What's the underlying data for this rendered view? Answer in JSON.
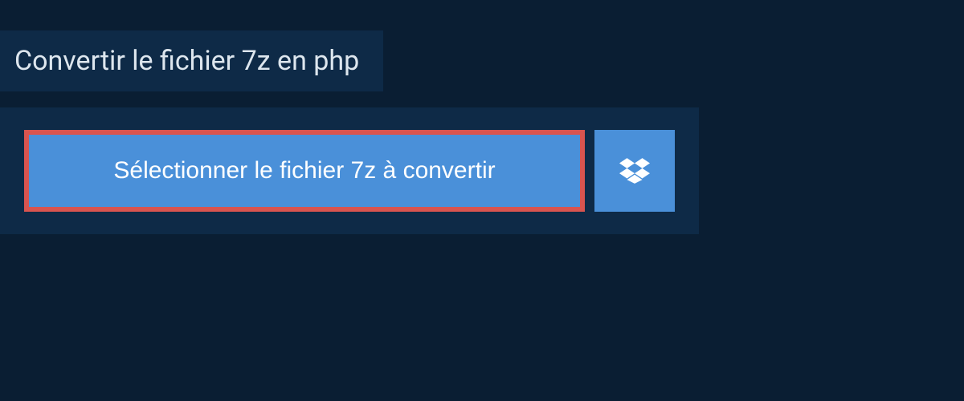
{
  "header": {
    "title": "Convertir le fichier 7z en php"
  },
  "upload": {
    "select_button_label": "Sélectionner le fichier 7z à convertir"
  },
  "colors": {
    "background": "#0a1e33",
    "panel": "#0e2a47",
    "button": "#4a90d9",
    "highlight_border": "#d9544f",
    "text_light": "#ffffff",
    "text_header": "#dde6ee"
  }
}
